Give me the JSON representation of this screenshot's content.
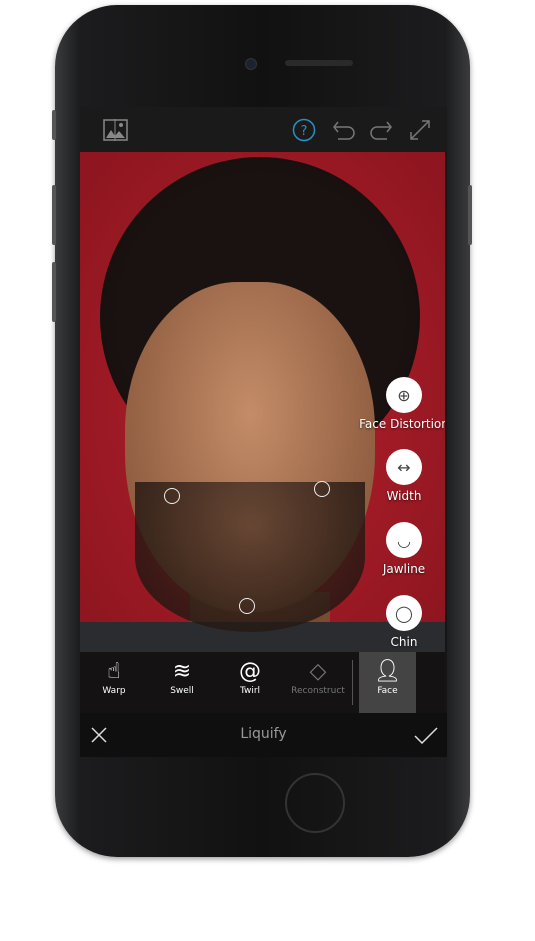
{
  "topbar": {
    "icons": [
      "compare-icon",
      "help-icon",
      "undo-icon",
      "redo-icon",
      "fullscreen-icon"
    ],
    "accent": "#2a8fc0"
  },
  "face_menu": [
    {
      "label": "Face Distortion",
      "icon": "globe-grid-icon"
    },
    {
      "label": "Width",
      "icon": "width-arrows-icon"
    },
    {
      "label": "Jawline",
      "icon": "jawline-icon"
    },
    {
      "label": "Chin",
      "icon": "chin-icon"
    }
  ],
  "tools": [
    {
      "label": "Warp",
      "icon": "warp-hand-icon"
    },
    {
      "label": "Swell",
      "icon": "swell-icon"
    },
    {
      "label": "Twirl",
      "icon": "twirl-icon"
    },
    {
      "label": "Reconstruct",
      "icon": "eraser-icon",
      "disabled": true
    },
    {
      "label": "Face",
      "icon": "face-icon",
      "active": true
    }
  ],
  "bottombar": {
    "title": "Liquify",
    "cancel_icon": "close-icon",
    "confirm_icon": "check-icon"
  }
}
